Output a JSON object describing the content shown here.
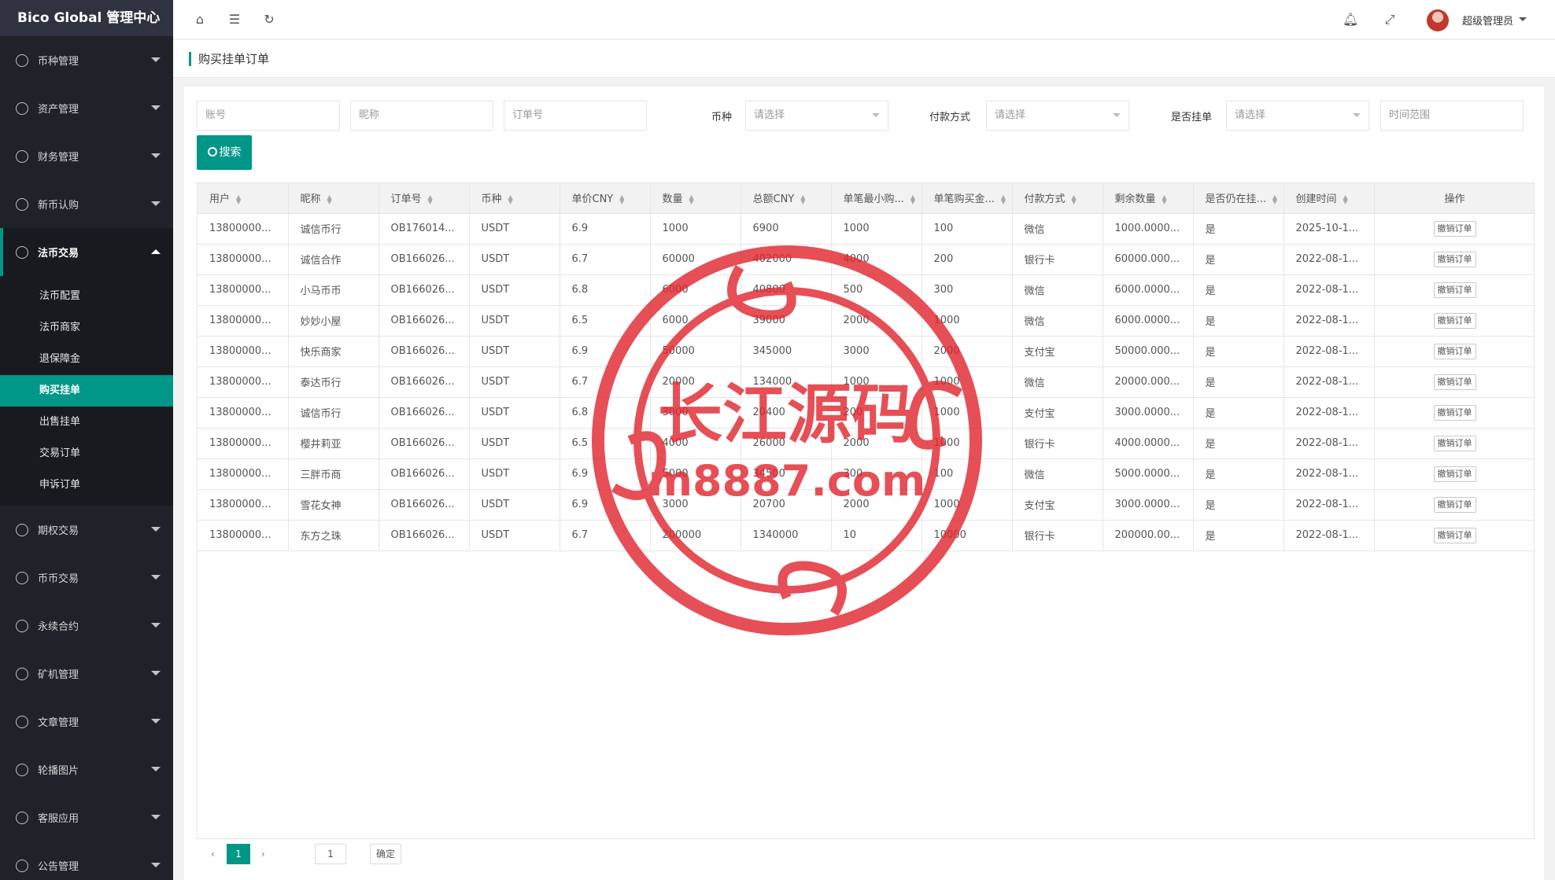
{
  "app": {
    "title": "Bico Global 管理中心"
  },
  "sidebar": {
    "items": [
      {
        "label": "币种管理",
        "icon": "coin-icon"
      },
      {
        "label": "资产管理",
        "icon": "dollar-icon"
      },
      {
        "label": "财务管理",
        "icon": "yen-icon"
      },
      {
        "label": "新币认购",
        "icon": "clock-icon"
      },
      {
        "label": "法币交易",
        "icon": "fire-icon",
        "expanded": true,
        "sub": [
          "法币配置",
          "法币商家",
          "退保障金",
          "购买挂单",
          "出售挂单",
          "交易订单",
          "申诉订单"
        ],
        "active_sub": "购买挂单"
      },
      {
        "label": "期权交易",
        "icon": "star-icon"
      },
      {
        "label": "币币交易",
        "icon": "exchange-icon"
      },
      {
        "label": "永续合约",
        "icon": "document-icon"
      },
      {
        "label": "矿机管理",
        "icon": "mining-icon"
      },
      {
        "label": "文章管理",
        "icon": "book-icon"
      },
      {
        "label": "轮播图片",
        "icon": "image-icon"
      },
      {
        "label": "客服应用",
        "icon": "headset-icon"
      },
      {
        "label": "公告管理",
        "icon": "bell-icon"
      }
    ]
  },
  "header": {
    "admin_name": "超级管理员"
  },
  "breadcrumb": {
    "title": "购买挂单订单"
  },
  "filters": {
    "account_placeholder": "账号",
    "nickname_placeholder": "昵称",
    "order_placeholder": "订单号",
    "coin_label": "币种",
    "coin_value": "请选择",
    "pay_label": "付款方式",
    "pay_value": "请选择",
    "listed_label": "是否挂单",
    "listed_value": "请选择",
    "time_placeholder": "时间范围",
    "search_label": "搜索"
  },
  "table": {
    "columns": [
      "用户",
      "昵称",
      "订单号",
      "币种",
      "单价CNY",
      "数量",
      "总额CNY",
      "单笔最小购...",
      "单笔购买金...",
      "付款方式",
      "剩余数量",
      "是否仍在挂...",
      "创建时间",
      "操作"
    ],
    "action_label": "撤销订单",
    "rows": [
      [
        "13800000...",
        "诚信币行",
        "OB176014...",
        "USDT",
        "6.9",
        "1000",
        "6900",
        "1000",
        "100",
        "微信",
        "1000.0000...",
        "是",
        "2025-10-1..."
      ],
      [
        "13800000...",
        "诚信合作",
        "OB166026...",
        "USDT",
        "6.7",
        "60000",
        "402000",
        "4000",
        "200",
        "银行卡",
        "60000.000...",
        "是",
        "2022-08-1..."
      ],
      [
        "13800000...",
        "小马币币",
        "OB166026...",
        "USDT",
        "6.8",
        "6000",
        "40800",
        "500",
        "300",
        "微信",
        "6000.0000...",
        "是",
        "2022-08-1..."
      ],
      [
        "13800000...",
        "妙妙小屋",
        "OB166026...",
        "USDT",
        "6.5",
        "6000",
        "39000",
        "2000",
        "1000",
        "微信",
        "6000.0000...",
        "是",
        "2022-08-1..."
      ],
      [
        "13800000...",
        "快乐商家",
        "OB166026...",
        "USDT",
        "6.9",
        "50000",
        "345000",
        "3000",
        "2000",
        "支付宝",
        "50000.000...",
        "是",
        "2022-08-1..."
      ],
      [
        "13800000...",
        "泰达币行",
        "OB166026...",
        "USDT",
        "6.7",
        "20000",
        "134000",
        "1000",
        "1000",
        "微信",
        "20000.000...",
        "是",
        "2022-08-1..."
      ],
      [
        "13800000...",
        "诚信币行",
        "OB166026...",
        "USDT",
        "6.8",
        "3000",
        "20400",
        "200",
        "1000",
        "支付宝",
        "3000.0000...",
        "是",
        "2022-08-1..."
      ],
      [
        "13800000...",
        "樱井莉亚",
        "OB166026...",
        "USDT",
        "6.5",
        "4000",
        "26000",
        "2000",
        "1000",
        "银行卡",
        "4000.0000...",
        "是",
        "2022-08-1..."
      ],
      [
        "13800000...",
        "三胖币商",
        "OB166026...",
        "USDT",
        "6.9",
        "5000",
        "34500",
        "300",
        "100",
        "微信",
        "5000.0000...",
        "是",
        "2022-08-1..."
      ],
      [
        "13800000...",
        "雪花女神",
        "OB166026...",
        "USDT",
        "6.9",
        "3000",
        "20700",
        "2000",
        "1000",
        "支付宝",
        "3000.0000...",
        "是",
        "2022-08-1..."
      ],
      [
        "13800000...",
        "东方之珠",
        "OB166026...",
        "USDT",
        "6.7",
        "200000",
        "1340000",
        "10",
        "10000",
        "银行卡",
        "200000.00...",
        "是",
        "2022-08-1..."
      ]
    ]
  },
  "pager": {
    "current": "1",
    "goto_value": "1",
    "confirm": "确定"
  },
  "watermark": {
    "line1": "长江源码",
    "line2": "m8887.com"
  },
  "colors": {
    "accent": "#009688",
    "sidebar_bg": "#20222a",
    "watermark": "#e0242c"
  }
}
